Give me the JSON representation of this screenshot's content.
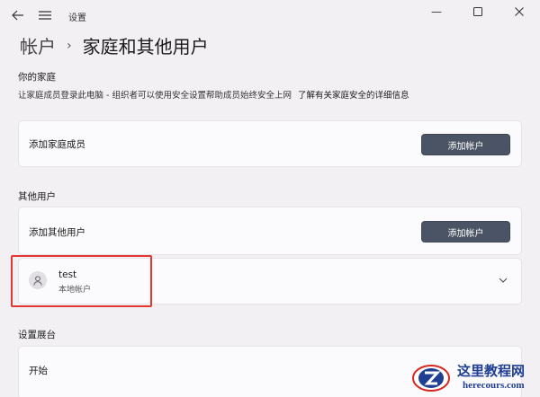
{
  "window": {
    "app_title": "设置",
    "controls": {
      "minimize": "—",
      "maximize": "☐",
      "close": "✕"
    }
  },
  "breadcrumb": {
    "parent": "帐户",
    "separator": "›",
    "current": "家庭和其他用户"
  },
  "family": {
    "title": "你的家庭",
    "description": "让家庭成员登录此电脑 - 组织者可以使用安全设置帮助成员始终安全上网",
    "link": "了解有关家庭安全的详细信息",
    "add_label": "添加家庭成员",
    "add_button": "添加帐户"
  },
  "other_users": {
    "title": "其他用户",
    "add_label": "添加其他用户",
    "add_button": "添加帐户",
    "users": [
      {
        "name": "test",
        "type": "本地帐户"
      }
    ]
  },
  "kiosk": {
    "title": "设置展台",
    "start_label": "开始"
  },
  "watermark": {
    "name": "这里教程网",
    "url": "herecours.com"
  },
  "colors": {
    "accent_button": "#4a5464",
    "highlight_box": "#e2362e",
    "watermark_blue": "#1f3f93",
    "watermark_red": "#d8261f"
  }
}
